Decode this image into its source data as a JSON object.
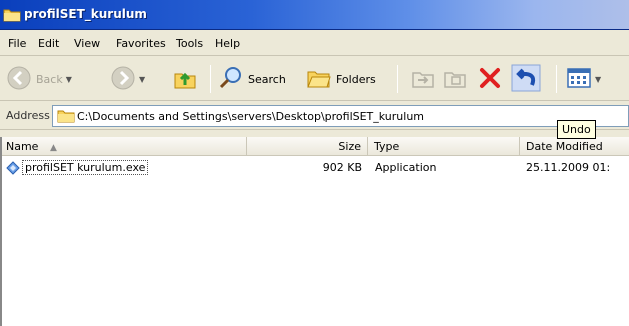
{
  "window": {
    "title": "profilSET_kurulum"
  },
  "menu": [
    "File",
    "Edit",
    "View",
    "Favorites",
    "Tools",
    "Help"
  ],
  "toolbar": {
    "back_label": "Back",
    "search_label": "Search",
    "folders_label": "Folders",
    "undo_tooltip": "Undo"
  },
  "address": {
    "label": "Address",
    "path": "C:\\Documents and Settings\\servers\\Desktop\\profilSET_kurulum"
  },
  "columns": {
    "name": "Name",
    "size": "Size",
    "type": "Type",
    "date": "Date Modified"
  },
  "files": [
    {
      "name": "profilSET kurulum.exe",
      "size": "902 KB",
      "type": "Application",
      "date": "25.11.2009 01:"
    }
  ],
  "colors": {
    "title_start": "#0a3fbc",
    "accent": "#2a63d6",
    "delete_red": "#e02020"
  }
}
